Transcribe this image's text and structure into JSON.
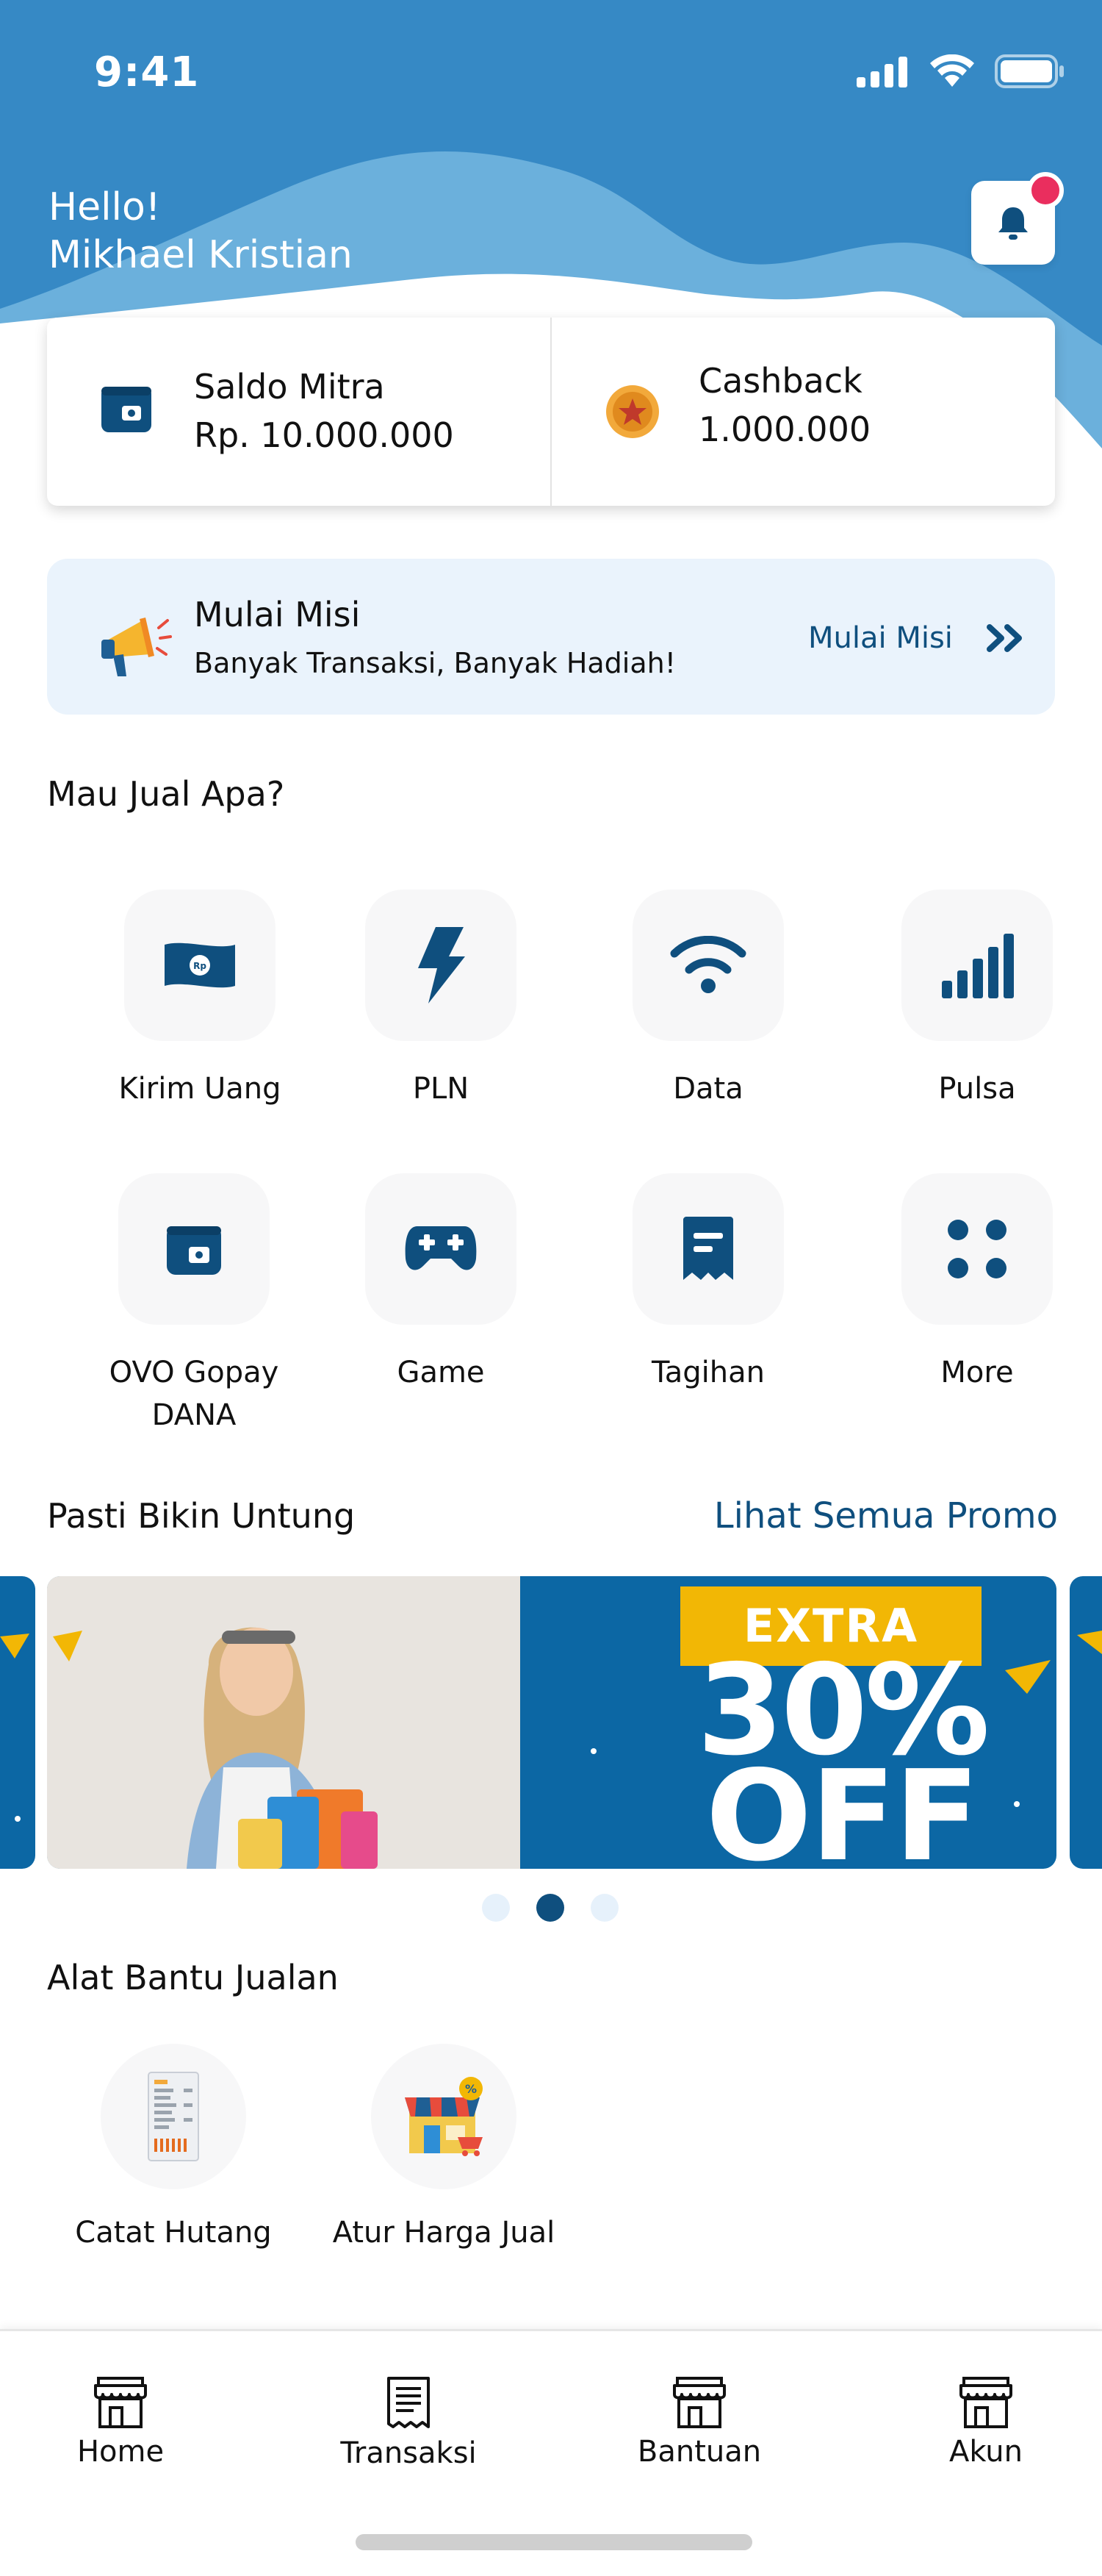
{
  "status_bar": {
    "time": "9:41"
  },
  "colors": {
    "primary": "#3689c5",
    "dark_blue": "#0f4f7e",
    "badge": "#ea2e5e",
    "mission_bg": "#eaf3fc"
  },
  "greeting": {
    "hello": "Hello!",
    "name": "Mikhael Kristian"
  },
  "notifications": {
    "icon": "bell-icon",
    "has_unread": true
  },
  "balance": [
    {
      "label": "Saldo Mitra",
      "value": "Rp. 10.000.000",
      "icon": "wallet-icon"
    },
    {
      "label": "Cashback",
      "value": "1.000.000",
      "icon": "coin-icon"
    }
  ],
  "mission": {
    "title": "Mulai Misi",
    "subtitle": "Banyak Transaksi, Banyak Hadiah!",
    "link": "Mulai Misi",
    "icon": "megaphone-icon"
  },
  "services": {
    "title": "Mau Jual Apa?",
    "items": [
      {
        "label": "Kirim Uang",
        "icon": "money-icon"
      },
      {
        "label": "PLN",
        "icon": "lightning-icon"
      },
      {
        "label": "Data",
        "icon": "wifi-icon"
      },
      {
        "label": "Pulsa",
        "icon": "signal-icon"
      },
      {
        "label": "OVO Gopay DANA",
        "icon": "wallet-icon"
      },
      {
        "label": "Game",
        "icon": "gamepad-icon"
      },
      {
        "label": "Tagihan",
        "icon": "bill-icon"
      },
      {
        "label": "More",
        "icon": "grid-icon"
      }
    ]
  },
  "promo": {
    "title": "Pasti Bikin Untung",
    "link": "Lihat Semua Promo",
    "banner": {
      "badge": "EXTRA",
      "percent": "30%",
      "off": "OFF"
    },
    "carousel_active_index": 1,
    "carousel_count": 3
  },
  "tools": {
    "title": "Alat Bantu Jualan",
    "items": [
      {
        "label": "Catat Hutang",
        "icon": "ledger-icon"
      },
      {
        "label": "Atur Harga Jual",
        "icon": "store-price-icon"
      }
    ]
  },
  "bottom_nav": [
    {
      "label": "Home",
      "icon": "store-icon"
    },
    {
      "label": "Transaksi",
      "icon": "receipt-icon"
    },
    {
      "label": "Bantuan",
      "icon": "store-icon"
    },
    {
      "label": "Akun",
      "icon": "store-icon"
    }
  ]
}
